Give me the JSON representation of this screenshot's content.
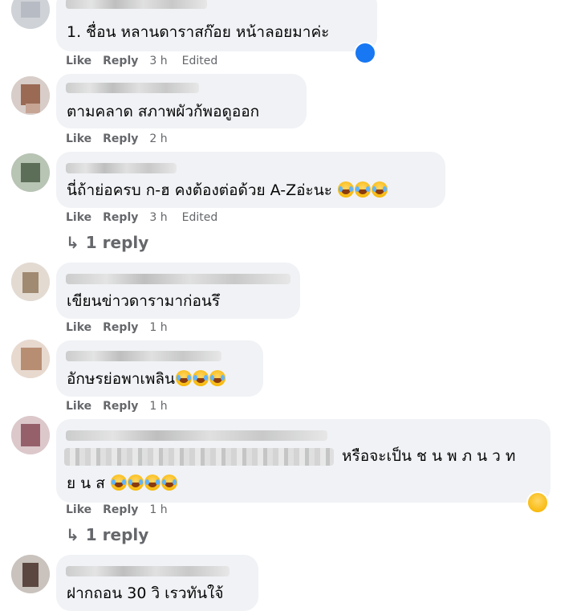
{
  "comments": [
    {
      "id": "c1",
      "text": "1. ชื่อน หลานดาราสก๊อย หน้าลอยมาค่ะ",
      "like": "Like",
      "reply": "Reply",
      "time": "3 h",
      "edited": "Edited",
      "reaction": "like-reaction",
      "emoji_count": 0
    },
    {
      "id": "c2",
      "text": "ตามคลาด สภาพผัวก้พอดูออก",
      "like": "Like",
      "reply": "Reply",
      "time": "2 h",
      "edited": "",
      "emoji_count": 0
    },
    {
      "id": "c3",
      "text": "นี่ถ้าย่อครบ ก-ฮ คงต้องต่อด้วย A-Zอ่ะนะ",
      "like": "Like",
      "reply": "Reply",
      "time": "3 h",
      "edited": "Edited",
      "emoji_count": 3,
      "replies": "1 reply"
    },
    {
      "id": "c4",
      "text": "เขียนข่าวดารามาก่อนรึ",
      "like": "Like",
      "reply": "Reply",
      "time": "1 h",
      "edited": "",
      "emoji_count": 0
    },
    {
      "id": "c5",
      "text": "อักษรย่อพาเพลิน",
      "like": "Like",
      "reply": "Reply",
      "time": "1 h",
      "edited": "",
      "emoji_count": 3
    },
    {
      "id": "c6",
      "text_line1": "หรือจะเป็น ช น พ ภ น ว ท",
      "text_line2": "ย น ส",
      "like": "Like",
      "reply": "Reply",
      "time": "1 h",
      "edited": "",
      "reaction": "haha-reaction",
      "emoji_count": 4,
      "replies": "1 reply"
    },
    {
      "id": "c7",
      "text": "ฝากถอน 30 วิ เรวทันใจ้",
      "emoji_count": 0
    }
  ]
}
